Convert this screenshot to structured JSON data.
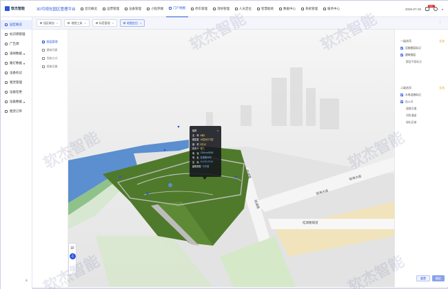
{
  "app": {
    "logo_text": "软杰智能",
    "system_title": "3D可视化园区管理平台"
  },
  "nav": [
    {
      "label": "首页概览",
      "active": false
    },
    {
      "label": "运营管理",
      "active": false
    },
    {
      "label": "设备管理",
      "active": false
    },
    {
      "label": "小程序端",
      "active": false
    },
    {
      "label": "门户地图",
      "active": true
    },
    {
      "label": "停车管理",
      "active": false
    },
    {
      "label": "消防管理",
      "active": false
    },
    {
      "label": "人员定位",
      "active": false
    },
    {
      "label": "智慧能耗",
      "active": false
    },
    {
      "label": "数据中心",
      "active": false
    },
    {
      "label": "系统管理",
      "active": false
    },
    {
      "label": "服务中心",
      "active": false
    }
  ],
  "topright": {
    "datetime": "2026-07-30",
    "badge": "99+",
    "caret": "▾"
  },
  "sidebar": [
    {
      "label": "园区概览",
      "active": true,
      "caret": false
    },
    {
      "label": "标识牌管理",
      "active": false,
      "caret": false
    },
    {
      "label": "广告牌",
      "active": false,
      "caret": false
    },
    {
      "label": "道闸数据",
      "active": false,
      "caret": true
    },
    {
      "label": "路灯数据",
      "active": false,
      "caret": true
    },
    {
      "label": "设备标记",
      "active": false,
      "caret": false
    },
    {
      "label": "租赁管理",
      "active": false,
      "caret": false
    },
    {
      "label": "设备巡更",
      "active": false,
      "caret": false
    },
    {
      "label": "设备数据",
      "active": false,
      "caret": true
    },
    {
      "label": "租赁订单",
      "active": false,
      "caret": false
    }
  ],
  "sidebar_collapse": "≡",
  "tabs": [
    {
      "label": "园区概览",
      "active": false
    },
    {
      "label": "地图工具",
      "active": false
    },
    {
      "label": "标签管理",
      "active": false
    },
    {
      "label": "地图定位",
      "active": true
    }
  ],
  "tab_close": "×",
  "tab_tools": "⋮",
  "layers": [
    {
      "label": "图层管理",
      "active": true
    },
    {
      "label": "建筑列表",
      "active": false
    },
    {
      "label": "导航方式",
      "active": false
    },
    {
      "label": "视角切换",
      "active": false
    }
  ],
  "map": {
    "road_labels": [
      "临海大道",
      "临海大道",
      "桂湖路",
      "桂湖路",
      "桂湖路辅道"
    ],
    "floor_label": "1F",
    "floor_button": "-1"
  },
  "popup": {
    "title": "建筑",
    "close": "×",
    "rows": [
      {
        "k": "名　称",
        "v": "B栋1"
      },
      {
        "k": "楼层数",
        "v": "16层/地下3层"
      },
      {
        "k": "面　积",
        "v": "8万㎡"
      },
      {
        "k": "负责人",
        "v": "张三"
      },
      {
        "k": "电　话",
        "v": "138xxxx8888"
      },
      {
        "k": "地　址",
        "v": "桂湖路88号"
      },
      {
        "k": "坐　标",
        "v": "114.05,22.54"
      },
      {
        "k": "建筑类型",
        "v": "写字楼"
      }
    ]
  },
  "right_panel": {
    "group1": {
      "title": "一级选项",
      "link": "全选",
      "checks": [
        "设施图层标记",
        "建筑物层"
      ],
      "subs": [
        "楼层平面标注"
      ]
    },
    "group2": {
      "title": "二级选项",
      "link": "全选",
      "checks": [
        "水电设施标记",
        "出入口"
      ],
      "subs": [
        "道路交通",
        "消防通道",
        "绿化区域"
      ]
    },
    "reset_label": "重置",
    "ok_label": "确定"
  },
  "watermark": "软杰智能",
  "colors": {
    "accent": "#2b56d8",
    "grass": "#4f7a2b",
    "water": "#5b8fcf",
    "ground": "#e6e6e6"
  }
}
